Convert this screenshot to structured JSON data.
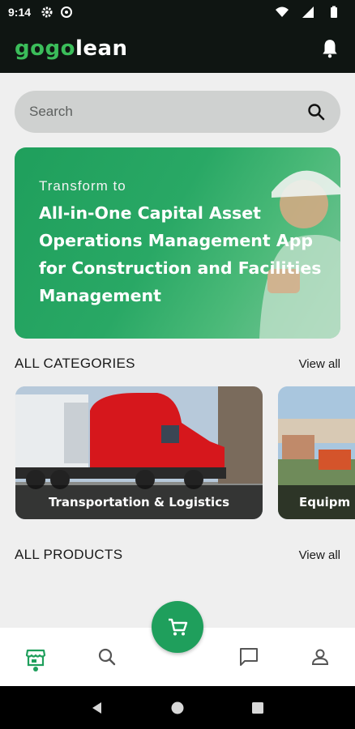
{
  "status_bar": {
    "time": "9:14"
  },
  "app": {
    "logo_part1": "gogo",
    "logo_part2": "lean"
  },
  "search": {
    "placeholder": "Search"
  },
  "banner": {
    "pre_title": "Transform to",
    "headline": "All-in-One Capital Asset Operations Management App for Construction and Facilities Management"
  },
  "categories": {
    "title": "ALL CATEGORIES",
    "view_all": "View all",
    "items": [
      {
        "label": "Transportation & Logistics"
      },
      {
        "label": "Equipm"
      }
    ]
  },
  "products": {
    "title": "ALL PRODUCTS",
    "view_all": "View all"
  },
  "bottom_nav": {
    "items": [
      "store-icon",
      "search-icon",
      "cart-icon",
      "chat-icon",
      "profile-icon"
    ],
    "active": "store-icon"
  },
  "colors": {
    "brand_green": "#1f9f5c",
    "dark_bar": "#0f1512",
    "search_bg": "#cfd1d0"
  }
}
